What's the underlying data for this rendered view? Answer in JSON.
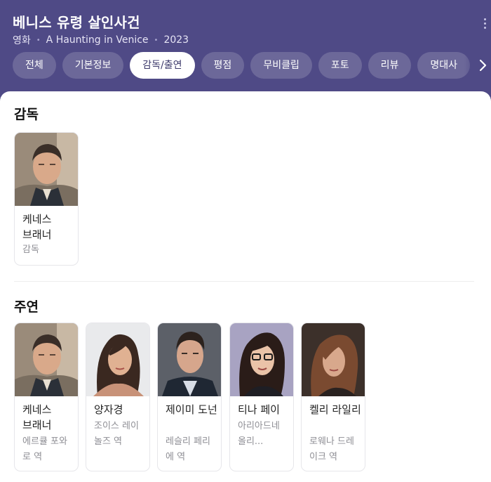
{
  "header": {
    "title": "베니스 유령 살인사건",
    "genre": "영화",
    "original_title": "A Haunting in Venice",
    "year": "2023",
    "tabs": [
      "전체",
      "기본정보",
      "감독/출연",
      "평점",
      "무비클립",
      "포토",
      "리뷰",
      "명대사"
    ],
    "active_tab": "감독/출연"
  },
  "director_section": {
    "title": "감독",
    "people": [
      {
        "name": "케네스 브래너",
        "role": "감독"
      }
    ]
  },
  "cast_section": {
    "title": "주연",
    "people": [
      {
        "name": "케네스 브래너",
        "role": "에르큘 포와로 역"
      },
      {
        "name": "양자경",
        "role": "조이스 레이놀즈 역"
      },
      {
        "name": "제이미 도넌",
        "role": "레슬리 페리에 역"
      },
      {
        "name": "티나 페이",
        "role": "아리아드네 올리..."
      },
      {
        "name": "켈리 라일리",
        "role": "로웨나 드레이크 역"
      }
    ]
  },
  "colors": {
    "header_bg": "#4f4a86",
    "tab_bg": "#6c6899",
    "active_tab_text": "#3d3a6b"
  },
  "icons": {
    "more": "kebab-icon",
    "next": "chevron-right-icon"
  }
}
